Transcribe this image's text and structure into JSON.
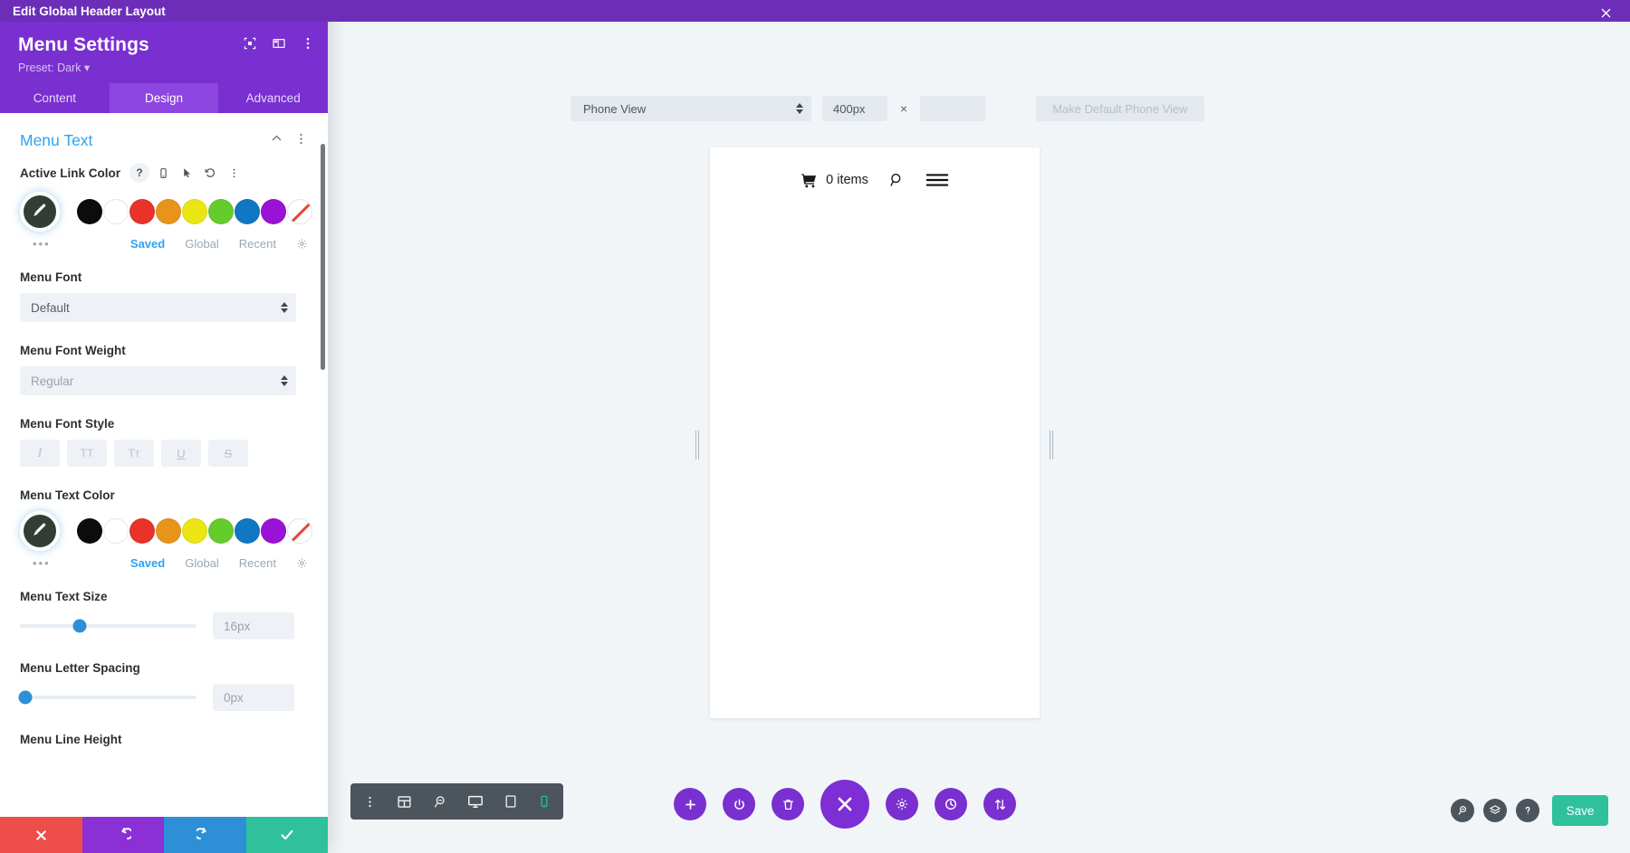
{
  "window": {
    "title": "Edit Global Header Layout",
    "close_icon": "close-icon"
  },
  "panel": {
    "header": {
      "title": "Menu Settings",
      "preset": "Preset: Dark ▾",
      "icons": [
        "focus-target-icon",
        "layout-columns-icon",
        "more-vertical-icon"
      ]
    },
    "tabs": [
      {
        "label": "Content",
        "active": false
      },
      {
        "label": "Design",
        "active": true
      },
      {
        "label": "Advanced",
        "active": false
      }
    ],
    "section": {
      "title": "Menu Text",
      "collapse_icon": "chevron-up-icon",
      "more_icon": "more-vertical-icon"
    },
    "fields": {
      "active_link_color": {
        "label": "Active Link Color",
        "icons": [
          "help-icon",
          "mobile-icon",
          "cursor-icon",
          "reset-icon",
          "more-vertical-icon"
        ],
        "swatches": [
          "#0c0c0c",
          "#ffffff",
          "#e8322a",
          "#e8941a",
          "#ebe513",
          "#65cc2c",
          "#1277c2",
          "#9a12d6",
          "none"
        ],
        "meta_tabs": [
          {
            "label": "Saved",
            "active": true
          },
          {
            "label": "Global",
            "active": false
          },
          {
            "label": "Recent",
            "active": false
          }
        ],
        "dots": "•••",
        "gear_icon": "gear-icon"
      },
      "menu_font": {
        "label": "Menu Font",
        "value": "Default"
      },
      "menu_font_weight": {
        "label": "Menu Font Weight",
        "value": "Regular"
      },
      "menu_font_style": {
        "label": "Menu Font Style",
        "buttons": [
          {
            "glyph": "I",
            "name": "italic-button"
          },
          {
            "glyph": "TT",
            "name": "uppercase-button"
          },
          {
            "glyph": "Tт",
            "name": "capitalize-button"
          },
          {
            "glyph": "U",
            "name": "underline-button"
          },
          {
            "glyph": "S",
            "name": "strikethrough-button"
          }
        ]
      },
      "menu_text_color": {
        "label": "Menu Text Color",
        "swatches": [
          "#0c0c0c",
          "#ffffff",
          "#e8322a",
          "#e8941a",
          "#ebe513",
          "#65cc2c",
          "#1277c2",
          "#9a12d6",
          "none"
        ],
        "meta_tabs": [
          {
            "label": "Saved",
            "active": true
          },
          {
            "label": "Global",
            "active": false
          },
          {
            "label": "Recent",
            "active": false
          }
        ],
        "dots": "•••",
        "gear_icon": "gear-icon"
      },
      "menu_text_size": {
        "label": "Menu Text Size",
        "value": "16px",
        "slider_percent": 34
      },
      "menu_letter_spacing": {
        "label": "Menu Letter Spacing",
        "value": "0px",
        "slider_percent": 2
      },
      "menu_line_height": {
        "label": "Menu Line Height"
      }
    },
    "footer": {
      "cancel": "close-icon",
      "undo": "undo-icon",
      "redo": "redo-icon",
      "save": "check-icon"
    }
  },
  "canvas": {
    "toolbar": {
      "view_select": "Phone View",
      "width_value": "400px",
      "separator": "×",
      "height_value": "",
      "make_default": "Make Default Phone View"
    },
    "preview": {
      "cart_icon": "shopping-cart-icon",
      "cart_label": "0 items",
      "search_icon": "search-icon",
      "menu_icon": "hamburger-menu-icon"
    },
    "module_toolbar": [
      {
        "name": "more-vertical-icon",
        "active": false
      },
      {
        "name": "wireframe-icon",
        "active": false
      },
      {
        "name": "zoom-out-icon",
        "active": false
      },
      {
        "name": "desktop-icon",
        "active": false
      },
      {
        "name": "tablet-icon",
        "active": false
      },
      {
        "name": "phone-icon",
        "active": true
      }
    ],
    "fabs": [
      {
        "name": "add-icon",
        "glyph": "+",
        "big": false
      },
      {
        "name": "power-icon",
        "glyph": "power",
        "big": false
      },
      {
        "name": "trash-icon",
        "glyph": "trash",
        "big": false
      },
      {
        "name": "close-builder-icon",
        "glyph": "close",
        "big": true
      },
      {
        "name": "settings-gear-icon",
        "glyph": "gear",
        "big": false
      },
      {
        "name": "history-icon",
        "glyph": "clock",
        "big": false
      },
      {
        "name": "sort-icon",
        "glyph": "sort",
        "big": false
      }
    ],
    "bottom_right": {
      "zoom_icon": "zoom-out-icon",
      "layers_icon": "layers-icon",
      "help_icon": "help-icon",
      "save_label": "Save"
    }
  },
  "colors": {
    "brand_purple": "#7a2fd0",
    "topbar_purple": "#6c2eb9",
    "accent_blue": "#2ea3f2",
    "save_green": "#2ec19c",
    "cancel_red": "#ed4e49"
  }
}
